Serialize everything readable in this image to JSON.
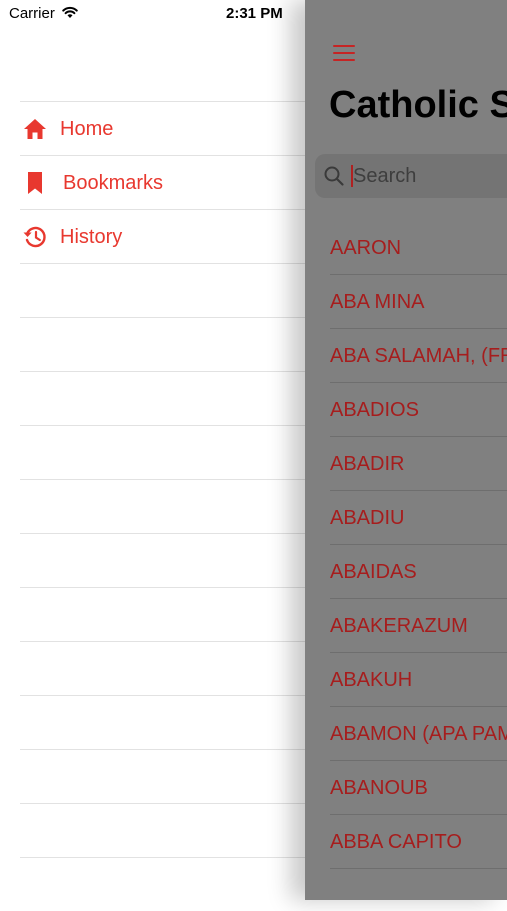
{
  "status_bar": {
    "carrier": "Carrier",
    "time": "2:31 PM"
  },
  "drawer": {
    "items": [
      {
        "label": "Home",
        "icon": "home-icon"
      },
      {
        "label": "Bookmarks",
        "icon": "bookmark-icon"
      },
      {
        "label": "History",
        "icon": "history-icon"
      }
    ]
  },
  "main": {
    "title": "Catholic S",
    "search": {
      "placeholder": "Search",
      "value": ""
    },
    "entries": [
      "AARON",
      "ABA MINA",
      "ABA SALAMAH, (FR",
      "ABADIOS",
      "ABADIR",
      "ABADIU",
      "ABAIDAS",
      "ABAKERAZUM",
      "ABAKUH",
      "ABAMON (APA PAM",
      "ABANOUB",
      "ABBA CAPITO"
    ]
  },
  "colors": {
    "accent": "#e8382f",
    "overlay": "#808080",
    "list_text": "#a61d1d"
  }
}
